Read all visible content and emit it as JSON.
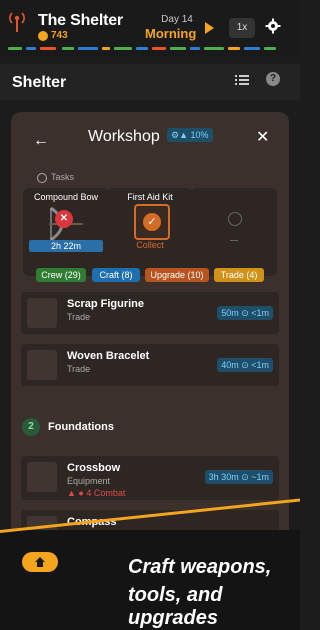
{
  "app": {
    "title": "The Shelter",
    "coins": "743",
    "day": "Day 14",
    "time_of_day": "Morning",
    "speed": "1x"
  },
  "header": {
    "title": "Shelter"
  },
  "workshop": {
    "title": "Workshop",
    "efficiency": "10%",
    "tasks_label": "Tasks",
    "tasks": [
      {
        "name": "Compound Bow",
        "timer": "2h 22m"
      },
      {
        "name": "First Aid Kit",
        "action": "Collect"
      },
      {
        "name": ""
      }
    ],
    "tabs": [
      {
        "label": "Crew (29)",
        "color": "#2e7d32"
      },
      {
        "label": "Craft (8)",
        "color": "#1e6fb0"
      },
      {
        "label": "Upgrade (10)",
        "color": "#b8541e"
      },
      {
        "label": "Trade (4)",
        "color": "#d2921a"
      }
    ],
    "trade_items": [
      {
        "name": "Scrap Figurine",
        "category": "Trade",
        "time": "50m ⊙ <1m"
      },
      {
        "name": "Woven Bracelet",
        "category": "Trade",
        "time": "40m ⊙ <1m"
      }
    ],
    "section": {
      "number": "2",
      "title": "Foundations"
    },
    "foundation_items": [
      {
        "name": "Crossbow",
        "category": "Equipment",
        "requirement": "▲ ● 4 Combat",
        "time": "3h 30m ⊙ ~1m"
      },
      {
        "name": "Compass",
        "category": "",
        "time": ""
      }
    ]
  },
  "promo": {
    "line1": "Craft weapons,",
    "line2": "tools, and upgrades"
  }
}
